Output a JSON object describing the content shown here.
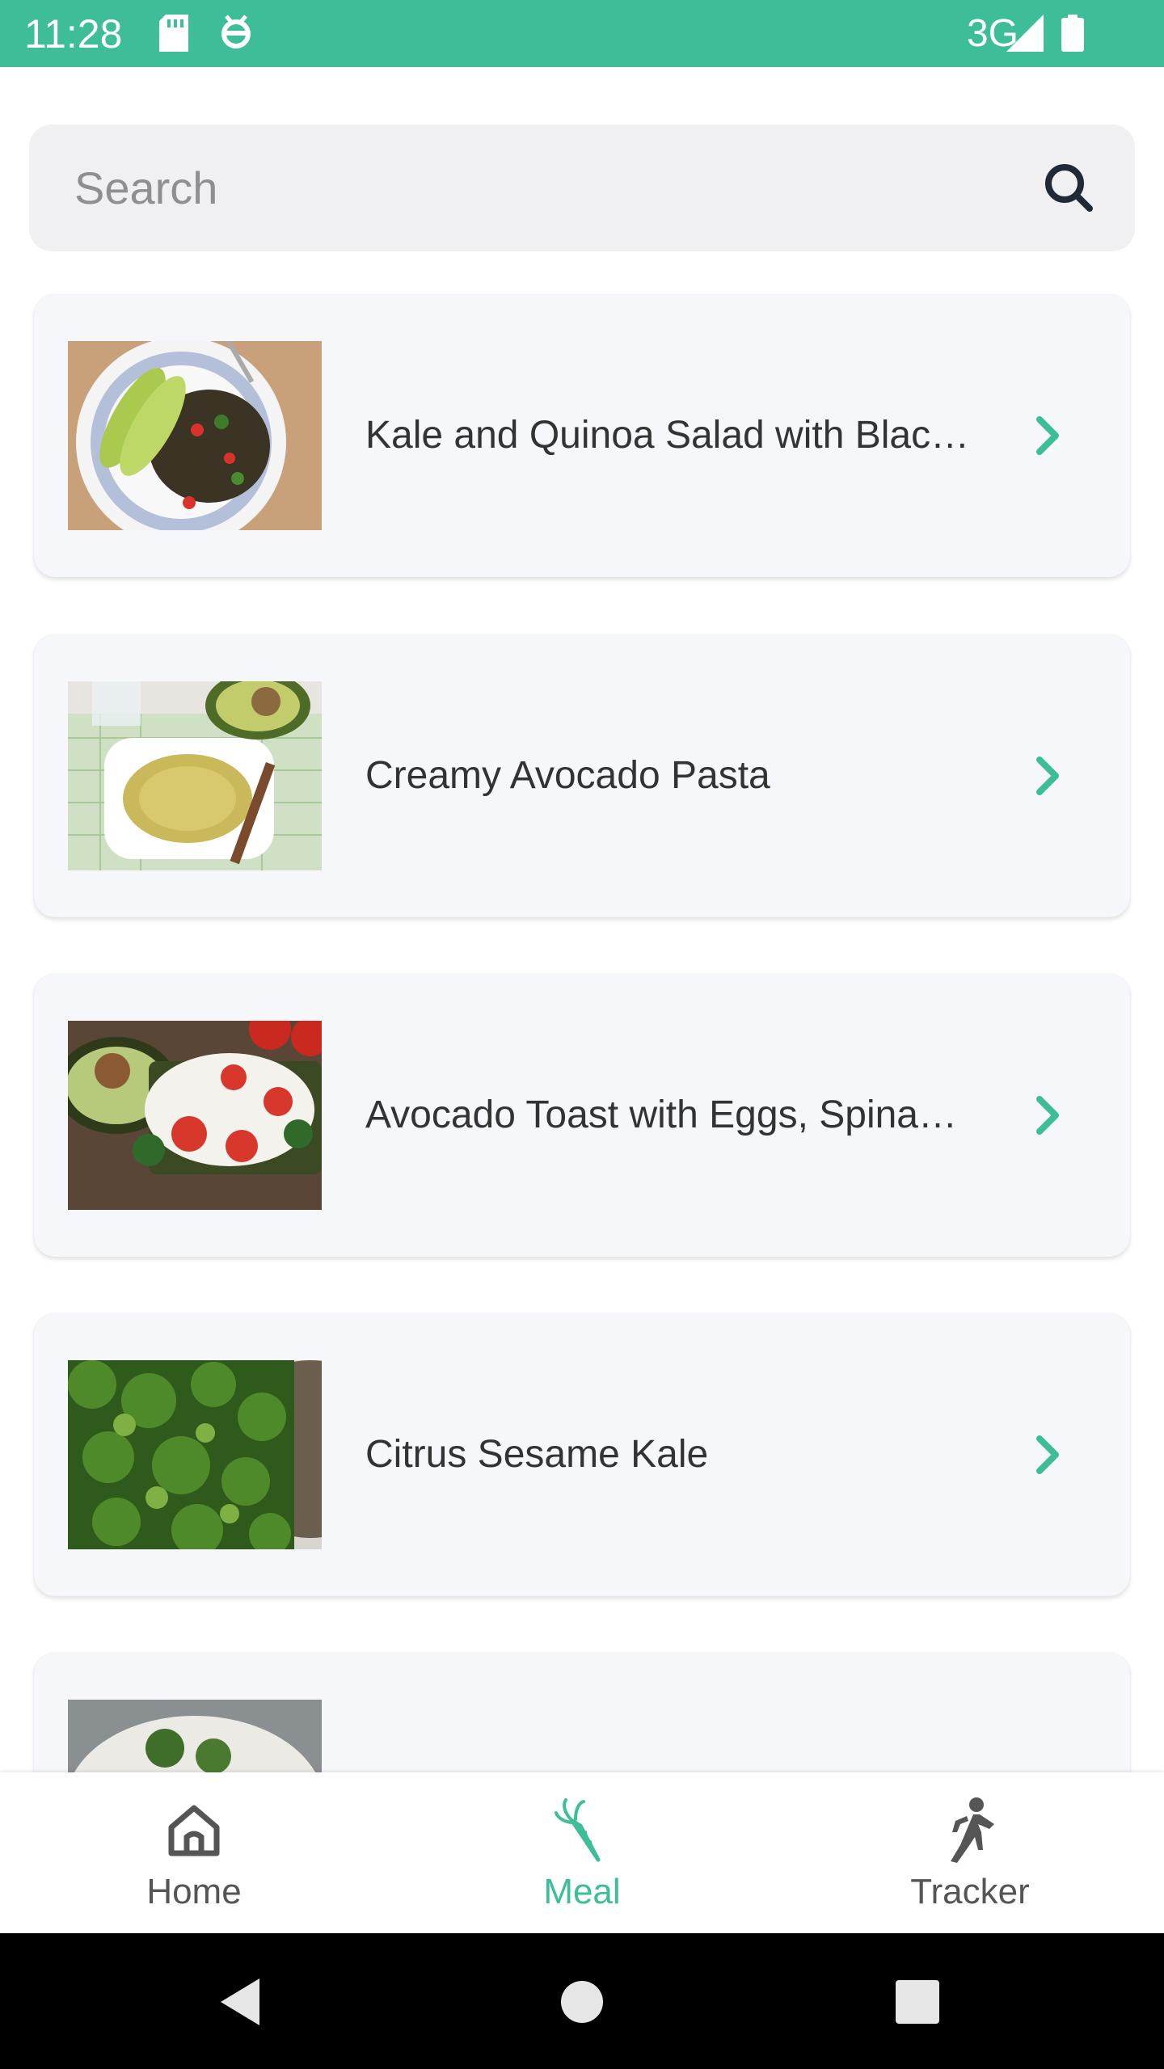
{
  "status_bar": {
    "time": "11:28",
    "network": "3G"
  },
  "search": {
    "placeholder": "Search"
  },
  "meals": [
    {
      "title": "Kale and Quinoa Salad with Blac…"
    },
    {
      "title": "Creamy Avocado Pasta"
    },
    {
      "title": "Avocado Toast with Eggs, Spina…"
    },
    {
      "title": "Citrus Sesame Kale"
    },
    {
      "title": ""
    }
  ],
  "bottom_nav": {
    "items": [
      {
        "label": "Home",
        "icon": "home-icon",
        "active": false
      },
      {
        "label": "Meal",
        "icon": "carrot-icon",
        "active": true
      },
      {
        "label": "Tracker",
        "icon": "runner-icon",
        "active": false
      }
    ]
  },
  "colors": {
    "accent": "#3dbe98",
    "card_bg": "#f6f7fb",
    "search_bg": "#f0f0f2"
  }
}
